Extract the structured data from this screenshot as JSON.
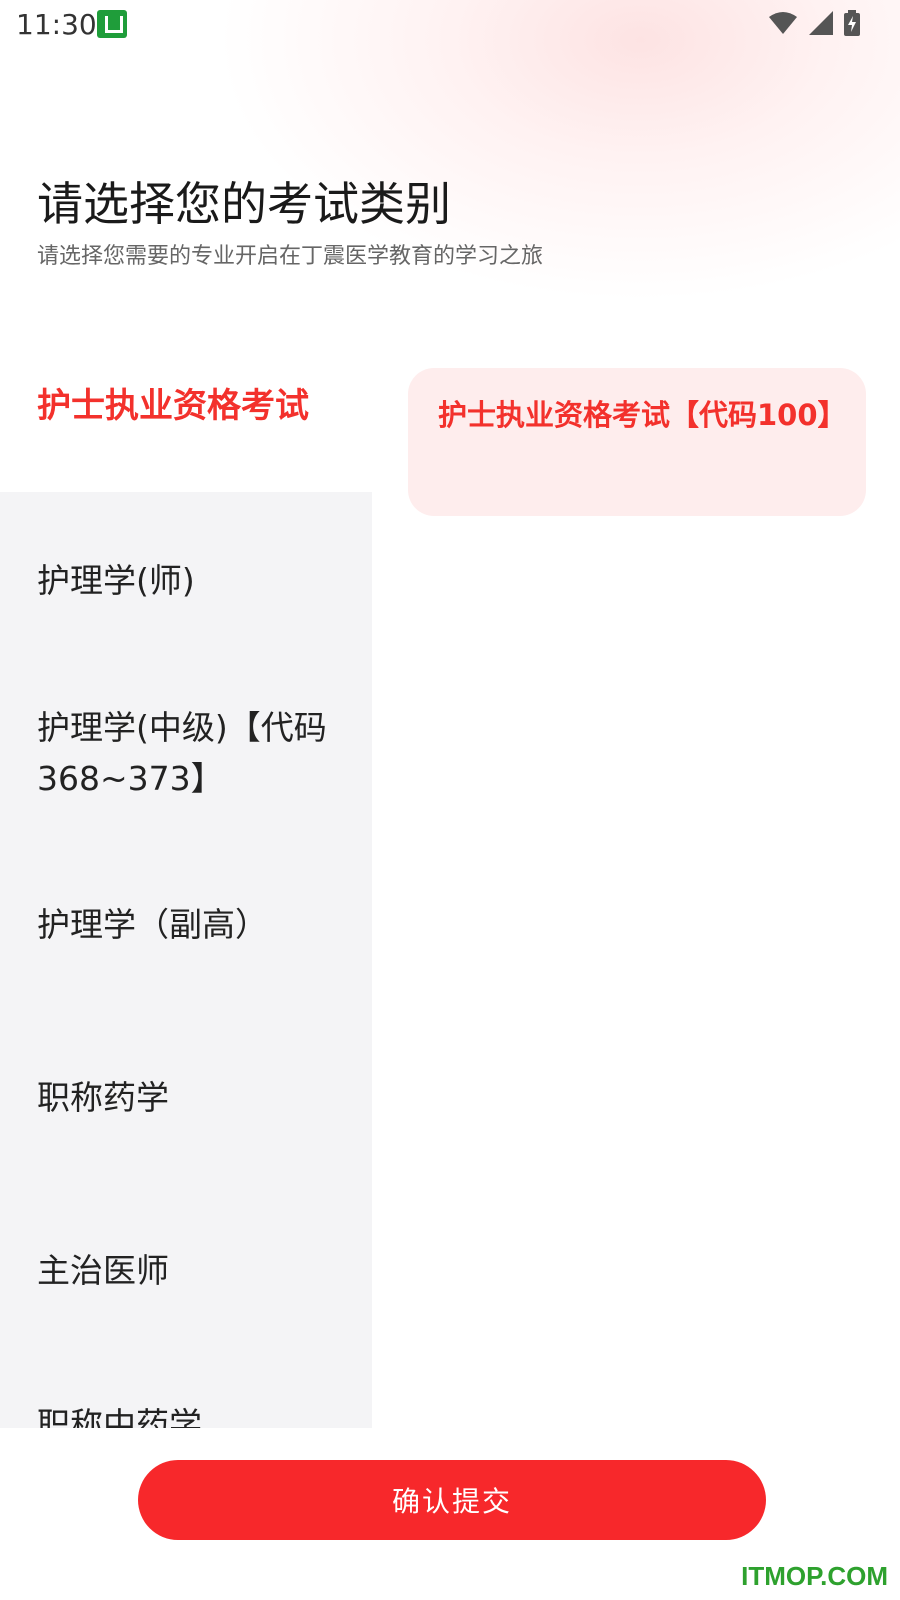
{
  "status_bar": {
    "time": "11:30",
    "app_icon": "notification-app-icon",
    "icons": [
      "wifi-icon",
      "signal-icon",
      "battery-icon"
    ]
  },
  "header": {
    "title": "请选择您的考试类别",
    "subtitle": "请选择您需要的专业开启在丁震医学教育的学习之旅"
  },
  "categories": [
    {
      "label": "护士执业资格考试",
      "active": true
    },
    {
      "label": "护理学(师)",
      "active": false
    },
    {
      "label": "护理学(中级)【代码368~373】",
      "active": false
    },
    {
      "label": "护理学（副高）",
      "active": false
    },
    {
      "label": "职称药学",
      "active": false
    },
    {
      "label": "主治医师",
      "active": false
    },
    {
      "label": "职称中药学",
      "active": false
    }
  ],
  "subcategories": [
    {
      "label": "护士执业资格考试【代码100】",
      "selected": true
    }
  ],
  "footer": {
    "confirm_label": "确认提交"
  },
  "watermark": "ITMOP.COM",
  "colors": {
    "accent": "#f3312c",
    "button": "#f7282b",
    "card_bg": "#feeded",
    "left_panel_bg": "#f4f4f6"
  }
}
